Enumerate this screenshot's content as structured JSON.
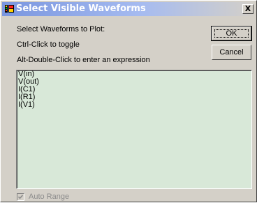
{
  "window": {
    "title": "Select Visible Waveforms",
    "close_label": "X"
  },
  "labels": {
    "prompt": "Select Waveforms to Plot:",
    "hint_toggle": "Ctrl-Click to toggle",
    "hint_expression": "Alt-Double-Click to enter an expression"
  },
  "buttons": {
    "ok": "OK",
    "cancel": "Cancel"
  },
  "waveforms": [
    "V(in)",
    "V(out)",
    "I(C1)",
    "I(R1)",
    "I(V1)"
  ],
  "auto_range": {
    "label": "Auto Range",
    "checked": true,
    "enabled": false
  },
  "colors": {
    "title_gradient_start": "#7a96df",
    "list_background": "#d8e8d8",
    "dialog_face": "#d4d0c8"
  },
  "icons": {
    "app": "ltspice-app-icon",
    "close": "close-icon",
    "check": "checkmark-icon"
  }
}
